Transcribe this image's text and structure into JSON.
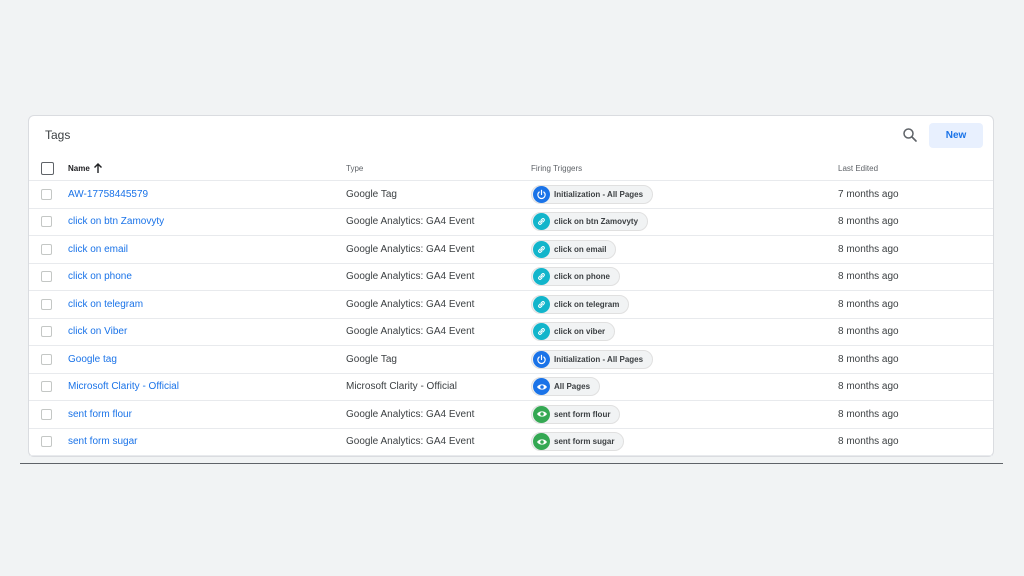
{
  "card": {
    "title": "Tags",
    "new_label": "New"
  },
  "columns": {
    "name": "Name",
    "type": "Type",
    "triggers": "Firing Triggers",
    "edited": "Last Edited"
  },
  "colors": {
    "init": "#1a73e8",
    "click": "#12b5cb",
    "pageview": "#34a853",
    "link": "#1a73e8"
  },
  "rows": [
    {
      "name": "AW-17758445579",
      "type": "Google Tag",
      "trigger": "Initialization - All Pages",
      "trigger_icon": "power-icon",
      "edited": "7 months ago"
    },
    {
      "name": "click on btn Zamovyty",
      "type": "Google Analytics: GA4 Event",
      "trigger": "click on btn Zamovyty",
      "trigger_icon": "link-icon",
      "edited": "8 months ago"
    },
    {
      "name": "click on email",
      "type": "Google Analytics: GA4 Event",
      "trigger": "click on email",
      "trigger_icon": "link-icon",
      "edited": "8 months ago"
    },
    {
      "name": "click on phone",
      "type": "Google Analytics: GA4 Event",
      "trigger": "click on phone",
      "trigger_icon": "link-icon",
      "edited": "8 months ago"
    },
    {
      "name": "click on telegram",
      "type": "Google Analytics: GA4 Event",
      "trigger": "click on telegram",
      "trigger_icon": "link-icon",
      "edited": "8 months ago"
    },
    {
      "name": "click on Viber",
      "type": "Google Analytics: GA4 Event",
      "trigger": "click on viber",
      "trigger_icon": "link-icon",
      "edited": "8 months ago"
    },
    {
      "name": "Google tag",
      "type": "Google Tag",
      "trigger": "Initialization - All Pages",
      "trigger_icon": "power-icon",
      "edited": "8 months ago"
    },
    {
      "name": "Microsoft Clarity - Official",
      "type": "Microsoft Clarity - Official",
      "trigger": "All Pages",
      "trigger_icon": "eye-icon-blue",
      "edited": "8 months ago"
    },
    {
      "name": "sent form flour",
      "type": "Google Analytics: GA4 Event",
      "trigger": "sent form flour",
      "trigger_icon": "eye-icon-green",
      "edited": "8 months ago"
    },
    {
      "name": "sent form sugar",
      "type": "Google Analytics: GA4 Event",
      "trigger": "sent form sugar",
      "trigger_icon": "eye-icon-green",
      "edited": "8 months ago"
    }
  ]
}
